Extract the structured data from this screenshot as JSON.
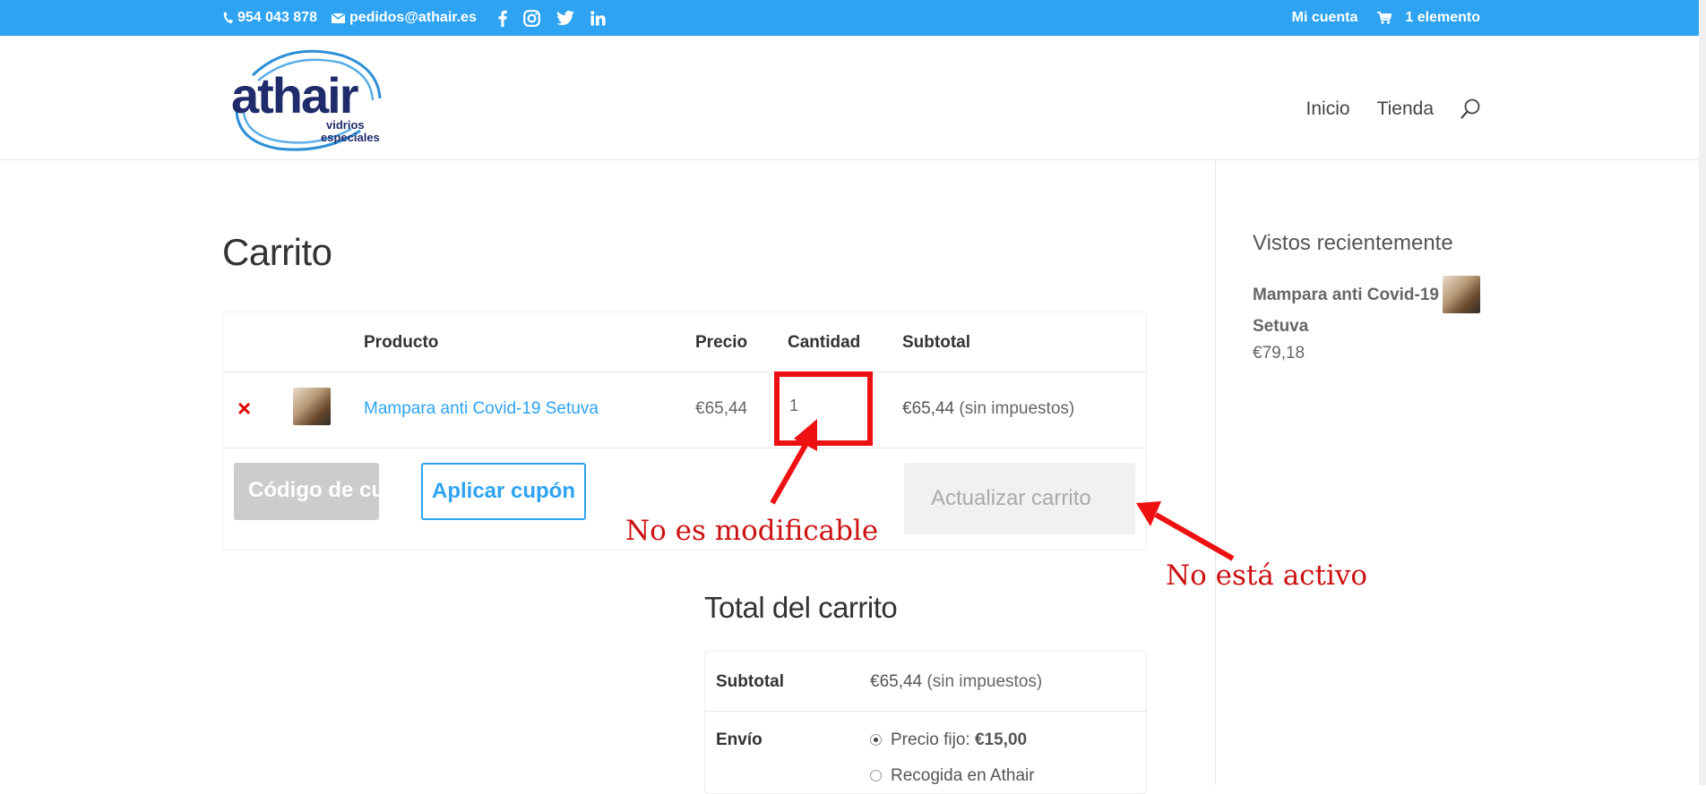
{
  "topbar": {
    "phone": "954 043 878",
    "email": "pedidos@athair.es",
    "account": "Mi cuenta",
    "cart_count": "1 elemento"
  },
  "logo": {
    "name": "athair",
    "line1": "vidrios",
    "line2": "especiales"
  },
  "nav": {
    "home": "Inicio",
    "shop": "Tienda"
  },
  "page_title": "Carrito",
  "cart_table": {
    "headers": {
      "product": "Producto",
      "price": "Precio",
      "quantity": "Cantidad",
      "subtotal": "Subtotal"
    },
    "row": {
      "remove": "×",
      "product": "Mampara anti Covid-19 Setuva",
      "price": "€65,44",
      "quantity": "1",
      "subtotal": "€65,44",
      "tax_note": "(sin impuestos)"
    },
    "coupon_placeholder": "Código de cupón",
    "apply_label": "Aplicar cupón",
    "update_label": "Actualizar carrito"
  },
  "annotations": {
    "not_editable": "No es modificable",
    "not_active": "No está activo"
  },
  "totals": {
    "title": "Total del carrito",
    "subtotal_label": "Subtotal",
    "subtotal_value": "€65,44",
    "subtotal_note": "(sin impuestos)",
    "shipping_label": "Envío",
    "option1_text": "Precio fijo:",
    "option1_price": "€15,00",
    "option2_text": "Recogida en Athair"
  },
  "sidebar": {
    "title": "Vistos recientemente",
    "product": "Mampara anti Covid-19 Setuva",
    "price": "€79,18"
  },
  "colors": {
    "accent": "#2ea3f2",
    "annotation": "#ee1111"
  }
}
